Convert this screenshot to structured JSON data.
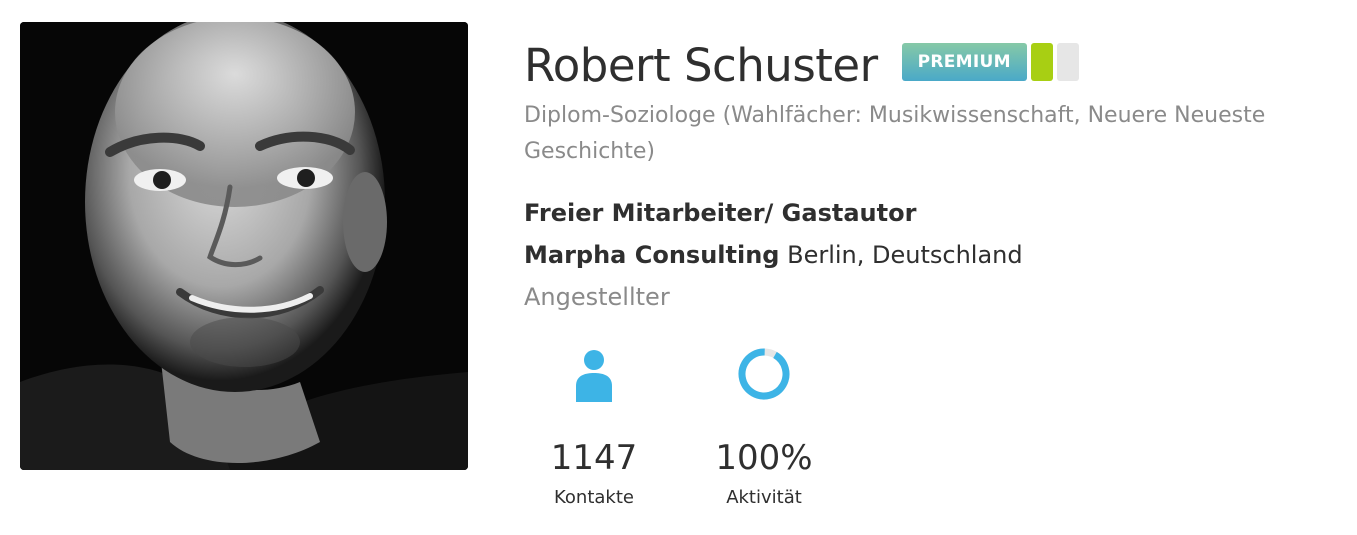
{
  "profile": {
    "name": "Robert Schuster",
    "badge": "PREMIUM",
    "degree": "Diplom-Soziologe (Wahlfächer: Musikwissenschaft, Neuere Neueste Geschichte)",
    "position": "Freier Mitarbeiter/ Gastautor",
    "company": "Marpha Consulting",
    "location": "Berlin, Deutschland",
    "employment": "Angestellter"
  },
  "stats": [
    {
      "value": "1147",
      "label": "Kontakte",
      "icon": "person-icon"
    },
    {
      "value": "100%",
      "label": "Aktivität",
      "icon": "activity-ring-icon",
      "activity_fraction": 1.0
    }
  ],
  "colors": {
    "accent": "#3db4e6",
    "premium_start": "#86c9a7",
    "premium_end": "#4aa9c8",
    "level_on": "#a8cf13",
    "level_off": "#e6e6e6",
    "text_dark": "#2f2f2f",
    "text_muted": "#8a8a8a"
  }
}
